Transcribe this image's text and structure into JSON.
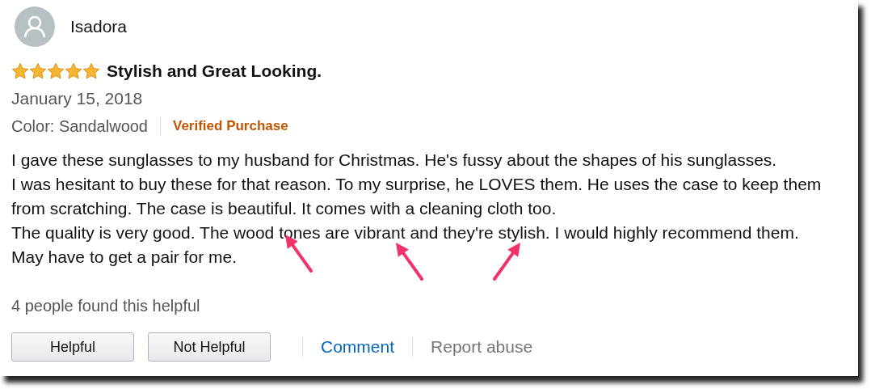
{
  "review": {
    "author": "Isadora",
    "stars": 5,
    "title": "Stylish and Great Looking.",
    "date": "January 15, 2018",
    "variant": "Color: Sandalwood",
    "badge": "Verified Purchase",
    "body_lines": [
      "I gave these sunglasses to my husband for Christmas. He's fussy about the shapes of his sunglasses.",
      "I was hesitant to buy these for that reason. To my surprise, he LOVES them. He uses the case to keep them",
      "from scratching. The case is beautiful. It comes with a cleaning cloth too.",
      "The quality is very good. The wood tones are vibrant and they're stylish. I would highly recommend them.",
      "May have to get a pair for me."
    ],
    "helpful_count": "4 people found this helpful",
    "buttons": [
      "Helpful",
      "Not Helpful"
    ],
    "links": [
      {
        "label": "Comment",
        "kind": "primary"
      },
      {
        "label": "Report abuse",
        "kind": "muted"
      }
    ]
  },
  "annotation_arrows": [
    {
      "kind": "leftward"
    },
    {
      "kind": "leftward"
    },
    {
      "kind": "rightward"
    }
  ]
}
